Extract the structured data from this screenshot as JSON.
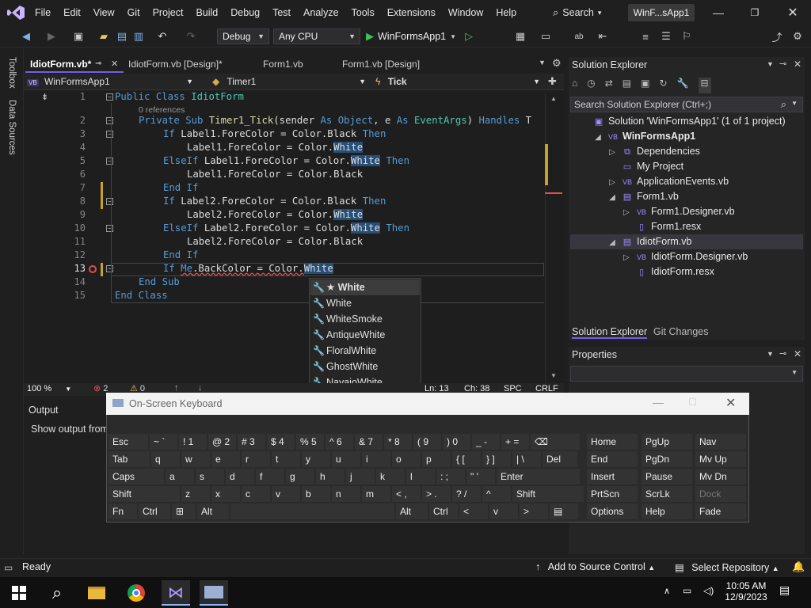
{
  "menu": [
    "File",
    "Edit",
    "View",
    "Git",
    "Project",
    "Build",
    "Debug",
    "Test",
    "Analyze",
    "Tools",
    "Extensions",
    "Window",
    "Help"
  ],
  "search_label": "Search",
  "solution_title": "WinF...sApp1",
  "toolbar": {
    "config": "Debug",
    "platform": "Any CPU",
    "run_target": "WinFormsApp1"
  },
  "left_rail": [
    "Toolbox",
    "Data Sources"
  ],
  "tabs": [
    {
      "label": "IdiotForm.vb*",
      "active": true
    },
    {
      "label": "IdiotForm.vb [Design]*"
    },
    {
      "label": "Form1.vb"
    },
    {
      "label": "Form1.vb [Design]"
    }
  ],
  "navbar": {
    "project": "WinFormsApp1",
    "object": "Timer1",
    "member": "Tick"
  },
  "code": {
    "line_numbers": [
      "1",
      "2",
      "3",
      "4",
      "5",
      "6",
      "7",
      "8",
      "9",
      "10",
      "11",
      "12",
      "13",
      "14",
      "15"
    ],
    "references": "0 references",
    "lines": [
      {
        "k1": "Public Class ",
        "t": "IdiotForm"
      },
      {
        "k1": "Private Sub ",
        "m": "Timer1_Tick",
        "rest": "(sender ",
        "k2": "As ",
        "k3": "Object",
        ", e ": "",
        "tail": ", e As EventArgs) Handles T"
      },
      {
        "text": "If Label1.ForeColor = Color.Black Then"
      },
      {
        "text": "Label1.ForeColor = Color.White"
      },
      {
        "text": "ElseIf Label1.ForeColor = Color.White Then"
      },
      {
        "text": "Label1.ForeColor = Color.Black"
      },
      {
        "text": "End If"
      },
      {
        "text": "If Label2.ForeColor = Color.Black Then"
      },
      {
        "text": "Label2.ForeColor = Color.White"
      },
      {
        "text": "ElseIf Label2.ForeColor = Color.White Then"
      },
      {
        "text": "Label2.ForeColor = Color.Black"
      },
      {
        "text": "End If"
      },
      {
        "text": "If Me.BackColor = Color.White"
      },
      {
        "text": "End Sub"
      },
      {
        "text": "End Class"
      }
    ]
  },
  "autocomplete": [
    {
      "label": "★ White",
      "selected": true
    },
    {
      "label": "White"
    },
    {
      "label": "WhiteSmoke"
    },
    {
      "label": "AntiqueWhite"
    },
    {
      "label": "FloralWhite"
    },
    {
      "label": "GhostWhite"
    },
    {
      "label": "NavajoWhite"
    }
  ],
  "editor_status": {
    "zoom": "100 %",
    "errors": "2",
    "warnings": "0",
    "line": "Ln: 13",
    "col": "Ch: 38",
    "spc": "SPC",
    "eol": "CRLF"
  },
  "output": {
    "title": "Output",
    "show_from": "Show output from:"
  },
  "solution_explorer": {
    "title": "Solution Explorer",
    "search_placeholder": "Search Solution Explorer (Ctrl+;)",
    "tree": [
      {
        "label": "Solution 'WinFormsApp1' (1 of 1 project)",
        "level": 0,
        "icon": "solution-icon"
      },
      {
        "label": "WinFormsApp1",
        "level": 1,
        "icon": "vb-project-icon",
        "bold": true
      },
      {
        "label": "Dependencies",
        "level": 2,
        "icon": "dependencies-icon"
      },
      {
        "label": "My Project",
        "level": 2,
        "icon": "my-project-icon"
      },
      {
        "label": "ApplicationEvents.vb",
        "level": 2,
        "icon": "vb-file-icon"
      },
      {
        "label": "Form1.vb",
        "level": 2,
        "icon": "form-icon"
      },
      {
        "label": "Form1.Designer.vb",
        "level": 3,
        "icon": "vb-file-icon"
      },
      {
        "label": "Form1.resx",
        "level": 3,
        "icon": "resx-icon"
      },
      {
        "label": "IdiotForm.vb",
        "level": 2,
        "icon": "form-icon",
        "selected": true
      },
      {
        "label": "IdiotForm.Designer.vb",
        "level": 3,
        "icon": "vb-file-icon"
      },
      {
        "label": "IdiotForm.resx",
        "level": 3,
        "icon": "resx-icon"
      }
    ],
    "tabs": [
      "Solution Explorer",
      "Git Changes"
    ]
  },
  "properties": {
    "title": "Properties"
  },
  "osk": {
    "title": "On-Screen Keyboard",
    "rows": [
      [
        "Esc",
        "~ `",
        "! 1",
        "@ 2",
        "# 3",
        "$ 4",
        "% 5",
        "^ 6",
        "& 7",
        "* 8",
        "( 9",
        ") 0",
        "_ -",
        "+ =",
        "⌫"
      ],
      [
        "Tab",
        "q",
        "w",
        "e",
        "r",
        "t",
        "y",
        "u",
        "i",
        "o",
        "p",
        "{ [",
        "} ]",
        "| \\",
        "Del"
      ],
      [
        "Caps",
        "a",
        "s",
        "d",
        "f",
        "g",
        "h",
        "j",
        "k",
        "l",
        ": ;",
        "\" '",
        "Enter"
      ],
      [
        "Shift",
        "z",
        "x",
        "c",
        "v",
        "b",
        "n",
        "m",
        "< ,",
        "> .",
        "? /",
        "^",
        "Shift"
      ],
      [
        "Fn",
        "Ctrl",
        "⊞",
        "Alt",
        "",
        "Alt",
        "Ctrl",
        "<",
        "v",
        ">",
        "▤"
      ]
    ],
    "side": [
      [
        "Home",
        "PgUp",
        "Nav"
      ],
      [
        "End",
        "PgDn",
        "Mv Up"
      ],
      [
        "Insert",
        "Pause",
        "Mv Dn"
      ],
      [
        "PrtScn",
        "ScrLk",
        "Dock"
      ],
      [
        "Options",
        "Help",
        "Fade"
      ]
    ]
  },
  "statusbar": {
    "ready": "Ready",
    "source_control": "Add to Source Control",
    "repo": "Select Repository"
  },
  "taskbar": {
    "time": "10:05 AM",
    "date": "12/9/2023"
  },
  "colors": {
    "accent": "#7160e8",
    "keyword": "#569cd6",
    "type": "#4ec9b0",
    "highlight": "#264f78"
  }
}
